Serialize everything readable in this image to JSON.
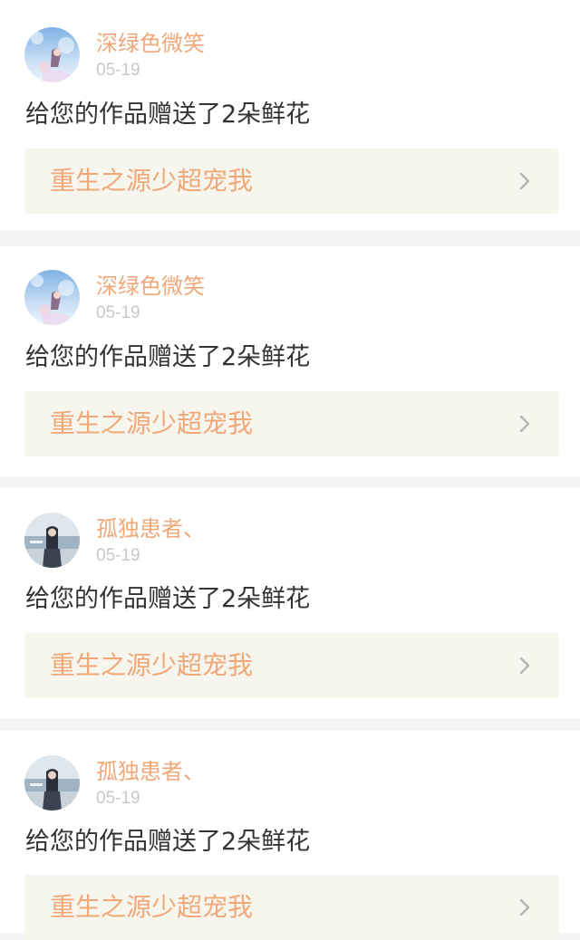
{
  "items": [
    {
      "username": "深绿色微笑",
      "date": "05-19",
      "message": "给您的作品赠送了2朵鲜花",
      "work_title": "重生之源少超宠我",
      "avatar_icon": "anime-girl-sky-avatar-icon"
    },
    {
      "username": "深绿色微笑",
      "date": "05-19",
      "message": "给您的作品赠送了2朵鲜花",
      "work_title": "重生之源少超宠我",
      "avatar_icon": "anime-girl-sky-avatar-icon"
    },
    {
      "username": "孤独患者、",
      "date": "05-19",
      "message": "给您的作品赠送了2朵鲜花",
      "work_title": "重生之源少超宠我",
      "avatar_icon": "girl-waterside-avatar-icon"
    },
    {
      "username": "孤独患者、",
      "date": "05-19",
      "message": "给您的作品赠送了2朵鲜花",
      "work_title": "重生之源少超宠我",
      "avatar_icon": "girl-waterside-avatar-icon"
    }
  ],
  "colors": {
    "accent": "#f0a878",
    "date": "#c9c9c9",
    "message": "#333333",
    "link_bg": "#f6f5ee",
    "page_bg": "#f5f5f5",
    "chevron": "#b5b5b5"
  }
}
